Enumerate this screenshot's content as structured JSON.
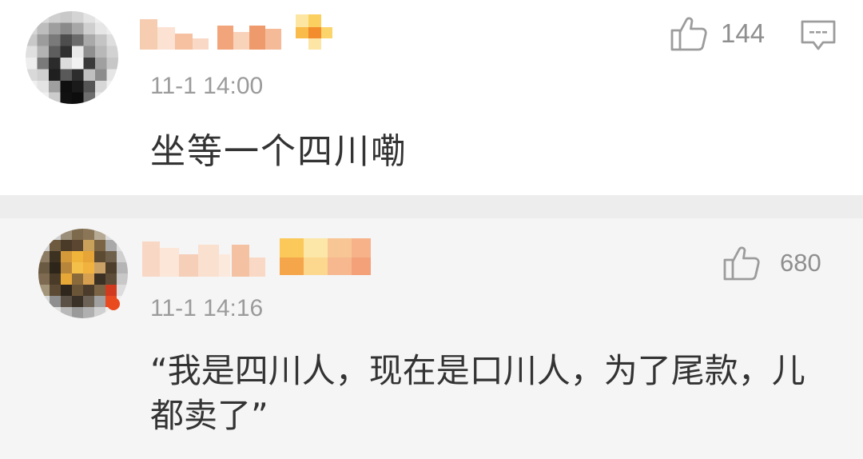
{
  "colors": {
    "text": "#333333",
    "meta": "#9b9b9b",
    "icon": "#9c9c9c",
    "separator": "#ededed",
    "second_comment_bg": "#f5f5f5"
  },
  "comments": [
    {
      "time": "11-1 14:00",
      "likes": "144",
      "text": "坐等一个四川嘞",
      "icons": {
        "like": "thumbs-up-icon",
        "reply": "comment-icon",
        "avatar": "pixelated-avatar"
      }
    },
    {
      "time": "11-1 14:16",
      "likes": "680",
      "text": "“我是四川人，现在是口川人，为了尾款，儿都卖了”",
      "icons": {
        "like": "thumbs-up-icon",
        "avatar": "pixelated-avatar"
      }
    }
  ]
}
